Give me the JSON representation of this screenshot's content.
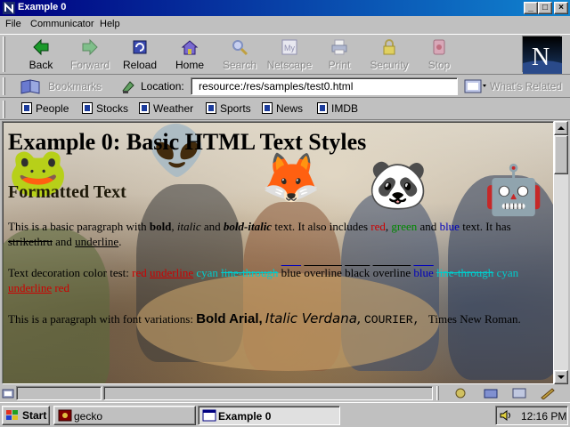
{
  "window": {
    "title": "Example 0",
    "buttons": {
      "minimize": "_",
      "maximize": "□",
      "close": "×"
    }
  },
  "menubar": {
    "items": [
      "File",
      "Communicator",
      "Help"
    ]
  },
  "toolbar": {
    "buttons": [
      {
        "label": "Back",
        "icon": "back-arrow-icon",
        "enabled": true
      },
      {
        "label": "Forward",
        "icon": "forward-arrow-icon",
        "enabled": false
      },
      {
        "label": "Reload",
        "icon": "reload-icon",
        "enabled": true
      },
      {
        "label": "Home",
        "icon": "home-icon",
        "enabled": true
      },
      {
        "label": "Search",
        "icon": "search-icon",
        "enabled": false
      },
      {
        "label": "Netscape",
        "icon": "netscape-icon",
        "enabled": false
      },
      {
        "label": "Print",
        "icon": "printer-icon",
        "enabled": false
      },
      {
        "label": "Security",
        "icon": "lock-icon",
        "enabled": false
      },
      {
        "label": "Stop",
        "icon": "stop-icon",
        "enabled": false
      }
    ],
    "throbber_letter": "N"
  },
  "location": {
    "bookmarks_label": "Bookmarks",
    "location_label": "Location:",
    "url": "resource:/res/samples/test0.html",
    "whats_related_label": "What's Related"
  },
  "personal_toolbar": {
    "items": [
      "People",
      "Stocks",
      "Weather",
      "Sports",
      "News",
      "IMDB"
    ]
  },
  "page": {
    "h1": "Example 0: Basic HTML Text Styles",
    "h2": "Formatted Text",
    "p1": {
      "a": "This is a basic paragraph with ",
      "bold": "bold",
      "b": ", ",
      "italic": "italic",
      "c": " and ",
      "bolditalic": "bold-italic",
      "d": " text. It also includes ",
      "red": "red",
      "e": ", ",
      "green": "green",
      "f": " and ",
      "blue": "blue",
      "g": " text. It has ",
      "strike": "strikethru",
      "h": " and ",
      "underline": "underline",
      "i": "."
    },
    "p2": {
      "lead": "Text decoration color test: ",
      "s1": "red",
      "s2": "underline",
      "s3": "cyan",
      "s4": "line-through",
      "s5": "blue",
      "s6": "overline",
      "s7": "black",
      "s8": "overline",
      "s9": "blue",
      "s10": "line-through",
      "s11": "cyan",
      "s12": "underline",
      "s13": "red"
    },
    "p3": {
      "lead": "This is a paragraph with font variations: ",
      "arial": "Bold Arial,",
      "verdana": "Italic Verdana,",
      "courier": "COURIER,",
      "times": "Times New Roman."
    },
    "emojis": [
      "🐸",
      "👽",
      "🦊",
      "🐼",
      "🤖"
    ]
  },
  "taskbar": {
    "start_label": "Start",
    "tasks": [
      {
        "label": "gecko",
        "active": false
      },
      {
        "label": "Example 0",
        "active": true
      }
    ],
    "clock": "12:16 PM"
  }
}
